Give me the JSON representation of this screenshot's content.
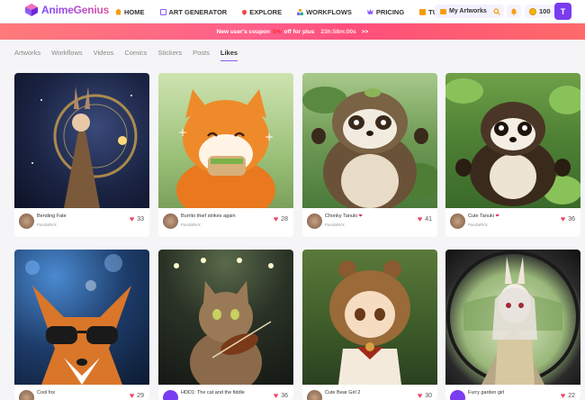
{
  "header": {
    "logo_text": "AnimeGenius",
    "nav": [
      {
        "label": "HOME",
        "icon": "home-icon",
        "color": "#f59e0b"
      },
      {
        "label": "ART GENERATOR",
        "icon": "image-icon",
        "color": "#8b5cf6"
      },
      {
        "label": "EXPLORE",
        "icon": "brush-icon",
        "color": "#ef4444"
      },
      {
        "label": "WORKFLOWS",
        "icon": "workflow-icon",
        "color": "#f59e0b"
      },
      {
        "label": "PRICING",
        "icon": "crown-icon",
        "color": "#8b5cf6"
      },
      {
        "label": "TUTORIAL",
        "icon": "book-icon",
        "color": "#f59e0b"
      }
    ],
    "my_artworks": "My Artworks",
    "credits": "100",
    "user_initial": "T"
  },
  "banner": {
    "text_before": "New user's coupon",
    "percent": "5%",
    "text_after": "off for plus",
    "timer": "23h:58m:00s",
    "arrow": ">>"
  },
  "tabs": [
    "Artworks",
    "Workflows",
    "Videos",
    "Comics",
    "Stickers",
    "Posts",
    "Likes"
  ],
  "active_tab": "Likes",
  "cards": [
    {
      "title": "Bending Fate",
      "user": "PandaRick",
      "likes": "33",
      "heart_title": false
    },
    {
      "title": "Burrito thief strikes again",
      "user": "PandaRick",
      "likes": "28",
      "heart_title": false
    },
    {
      "title": "Chonky Tanuki",
      "user": "PandaRick",
      "likes": "41",
      "heart_title": true
    },
    {
      "title": "Cute Tanuki",
      "user": "PandaRick",
      "likes": "36",
      "heart_title": true
    },
    {
      "title": "Cool fox",
      "user": "",
      "likes": "29",
      "heart_title": false
    },
    {
      "title": "HDD1: The cat and the fiddle",
      "user": "",
      "likes": "36",
      "heart_title": false
    },
    {
      "title": "Cute Bear Girl 2",
      "user": "",
      "likes": "30",
      "heart_title": false
    },
    {
      "title": "Furry garden girl",
      "user": "",
      "likes": "22",
      "heart_title": false
    }
  ],
  "colors": {
    "accent": "#7a3cf0",
    "banner": "#ff5e8a",
    "heart": "#f0436a"
  }
}
